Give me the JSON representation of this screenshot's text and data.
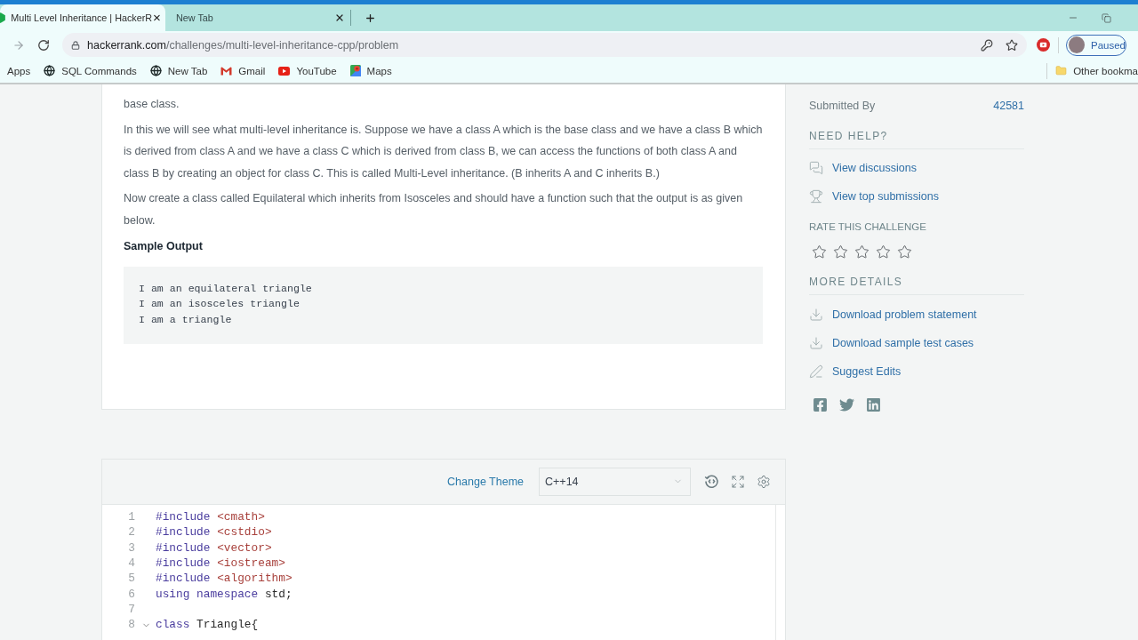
{
  "browser": {
    "tabs": [
      {
        "title": "Multi Level Inheritance | HackerR",
        "selected": true
      },
      {
        "title": "New Tab",
        "selected": false
      }
    ],
    "url": {
      "host": "hackerrank.com",
      "path": "/challenges/multi-level-inheritance-cpp/problem"
    },
    "profile": {
      "label": "Paused"
    },
    "bookmarks": [
      {
        "kind": "apps",
        "label": "Apps"
      },
      {
        "kind": "globe",
        "label": "SQL Commands"
      },
      {
        "kind": "globe",
        "label": "New Tab"
      },
      {
        "kind": "gmail",
        "label": "Gmail"
      },
      {
        "kind": "youtube",
        "label": "YouTube"
      },
      {
        "kind": "maps",
        "label": "Maps"
      }
    ],
    "other_bookmarks": "Other bookma"
  },
  "problem": {
    "paragraphs": [
      "base class.",
      "In this we will see what multi-level inheritance is. Suppose we have a class A which is the base class and we have a class B which is derived from class A and we have a class C which is derived from class B, we can access the functions of both class A and class B by creating an object for class C. This is called Multi-Level inheritance. (B inherits A and C inherits B.)",
      "Now create a class called Equilateral which inherits from Isosceles and should have a function such that the output is as given below."
    ],
    "sample_output": {
      "title": "Sample Output",
      "lines": [
        "I am an equilateral triangle",
        "I am an isosceles triangle",
        "I am a triangle"
      ]
    }
  },
  "sidebar": {
    "stats": [
      {
        "label": "Submitted By",
        "value": "42581"
      }
    ],
    "need_help": {
      "title": "NEED HELP?",
      "links": [
        {
          "kind": "discussions",
          "label": "View discussions"
        },
        {
          "kind": "trophy",
          "label": "View top submissions"
        }
      ]
    },
    "rating": {
      "title": "RATE THIS CHALLENGE",
      "stars": 0
    },
    "more_details": {
      "title": "MORE DETAILS",
      "links": [
        {
          "kind": "download",
          "label": "Download problem statement"
        },
        {
          "kind": "download",
          "label": "Download sample test cases"
        },
        {
          "kind": "edit",
          "label": "Suggest Edits"
        }
      ]
    }
  },
  "editor": {
    "change_theme": "Change Theme",
    "language": "C++14",
    "lines": [
      {
        "number": "1",
        "foldable": false,
        "tokens": [
          {
            "kind": "keyword",
            "text": "#include "
          },
          {
            "kind": "string",
            "text": "<cmath>"
          }
        ]
      },
      {
        "number": "2",
        "foldable": false,
        "tokens": [
          {
            "kind": "keyword",
            "text": "#include "
          },
          {
            "kind": "string",
            "text": "<cstdio>"
          }
        ]
      },
      {
        "number": "3",
        "foldable": false,
        "tokens": [
          {
            "kind": "keyword",
            "text": "#include "
          },
          {
            "kind": "string",
            "text": "<vector>"
          }
        ]
      },
      {
        "number": "4",
        "foldable": false,
        "tokens": [
          {
            "kind": "keyword",
            "text": "#include "
          },
          {
            "kind": "string",
            "text": "<iostream>"
          }
        ]
      },
      {
        "number": "5",
        "foldable": false,
        "tokens": [
          {
            "kind": "keyword",
            "text": "#include "
          },
          {
            "kind": "string",
            "text": "<algorithm>"
          }
        ]
      },
      {
        "number": "6",
        "foldable": false,
        "tokens": [
          {
            "kind": "keyword",
            "text": "using namespace "
          },
          {
            "kind": "plain",
            "text": "std;"
          }
        ]
      },
      {
        "number": "7",
        "foldable": false
      },
      {
        "number": "8",
        "foldable": true,
        "tokens": [
          {
            "kind": "keyword",
            "text": "class "
          },
          {
            "kind": "plain",
            "text": "Triangle{"
          }
        ]
      }
    ]
  }
}
